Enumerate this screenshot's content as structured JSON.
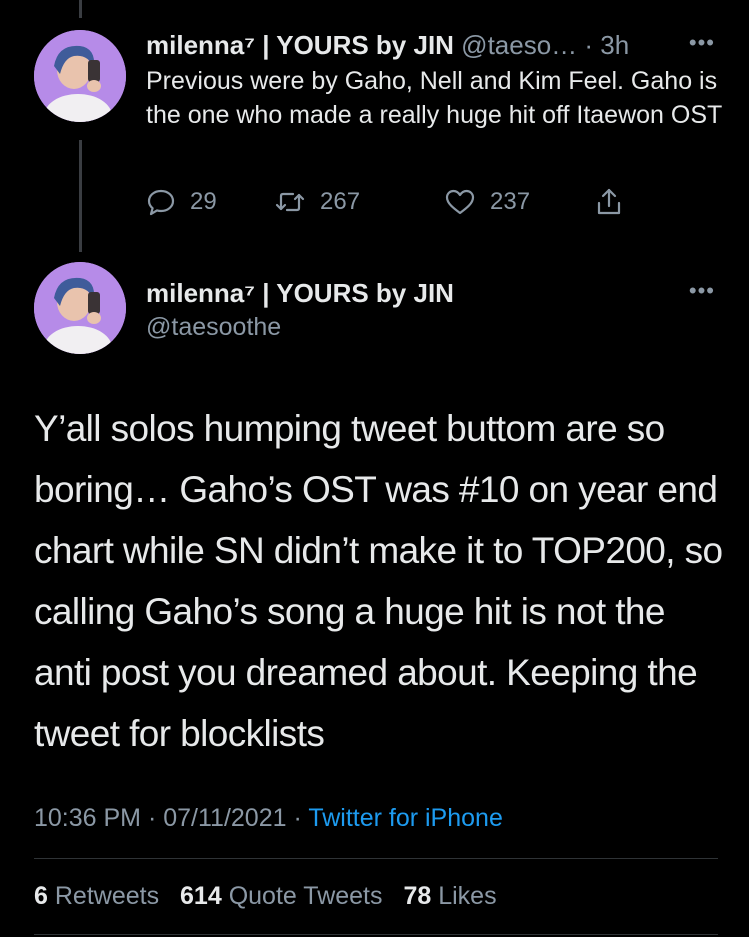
{
  "reply_tweet": {
    "display_name": "milenna⁷ | YOURS by JIN",
    "handle": "@taeso…",
    "time": "· 3h",
    "text": "Previous were by Gaho, Nell and Kim Feel. Gaho is the one who made a really huge hit off Itaewon OST",
    "reply_count": "29",
    "retweet_count": "267",
    "like_count": "237"
  },
  "main_tweet": {
    "display_name": "milenna⁷ | YOURS by JIN",
    "handle": "@taesoothe",
    "text": "Y’all solos humping tweet buttom are so boring… Gaho’s OST was #10 on year end chart while SN didn’t make it to TOP200, so calling Gaho’s song a huge hit is not the anti post you dreamed about. Keeping the tweet for blocklists",
    "time": "10:36 PM",
    "date": "07/11/2021",
    "source": "Twitter for iPhone",
    "retweets_count": "6",
    "retweets_label": "Retweets",
    "quote_tweets_count": "614",
    "quote_tweets_label": "Quote Tweets",
    "likes_count": "78",
    "likes_label": "Likes"
  },
  "icons": {
    "more": "more-horizontal-icon",
    "reply": "speech-bubble-icon",
    "retweet": "retweet-arrows-icon",
    "like": "heart-icon",
    "share": "share-upload-icon"
  },
  "colors": {
    "background": "#000000",
    "text": "#e7e9ea",
    "muted": "#8b98a5",
    "link": "#1d9bf0",
    "avatar_bg": "#b68be8"
  }
}
